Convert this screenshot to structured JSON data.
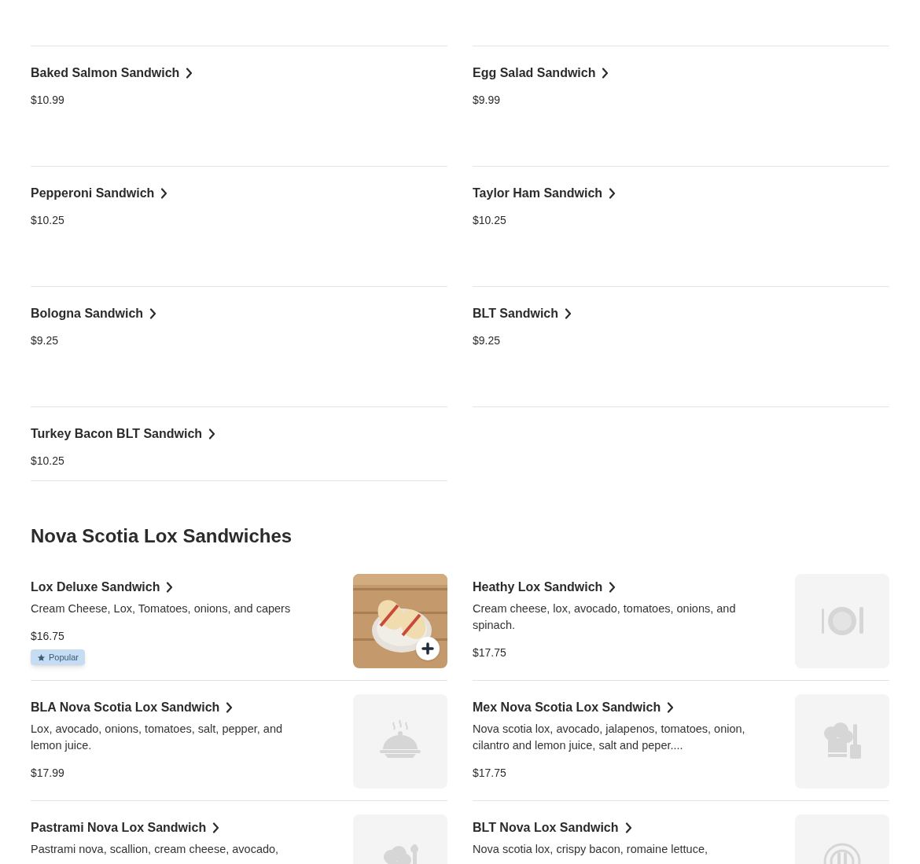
{
  "sandwiches": [
    {
      "name": "Baked Salmon Sandwich",
      "price": "$10.99"
    },
    {
      "name": "Egg Salad Sandwich",
      "price": "$9.99"
    },
    {
      "name": "Pepperoni Sandwich",
      "price": "$10.25"
    },
    {
      "name": "Taylor Ham Sandwich",
      "price": "$10.25"
    },
    {
      "name": "Bologna Sandwich",
      "price": "$9.25"
    },
    {
      "name": "BLT Sandwich",
      "price": "$9.25"
    },
    {
      "name": "Turkey Bacon BLT Sandwich",
      "price": "$10.25"
    }
  ],
  "nova_section": {
    "title": "Nova Scotia Lox Sandwiches",
    "items": [
      {
        "name": "Lox Deluxe Sandwich",
        "description": "Cream Cheese, Lox, Tomatoes, onions, and capers",
        "price": "$16.75",
        "badge": "Popular",
        "kind": "picture"
      },
      {
        "name": "Heathy Lox Sandwich",
        "description": "Cream cheese, lox, avocado, tomatoes, onions, and spinach.",
        "price": "$17.75",
        "kind": "placeholder"
      },
      {
        "name": "BLA Nova Scotia Lox Sandwich",
        "description": "Lox, avocado, onions, tomatoes, salt, pepper, and lemon juice.",
        "price": "$17.99",
        "kind": "placeholder"
      },
      {
        "name": "Mex Nova Scotia Lox Sandwich",
        "description": "Nova scotia lox, avocado, jalapenos, tomatoes, onion, cilantro and lemon juice, salt and peper....",
        "price": "$17.75",
        "kind": "placeholder"
      },
      {
        "name": "Pastrami Nova Lox Sandwich",
        "description": "Pastrami nova, scallion, cream cheese, avocado,",
        "kind": "placeholder"
      },
      {
        "name": "BLT Nova Lox Sandwich",
        "description": "Nova scotia lox, crispy bacon, romaine lettuce,",
        "kind": "placeholder"
      }
    ]
  }
}
